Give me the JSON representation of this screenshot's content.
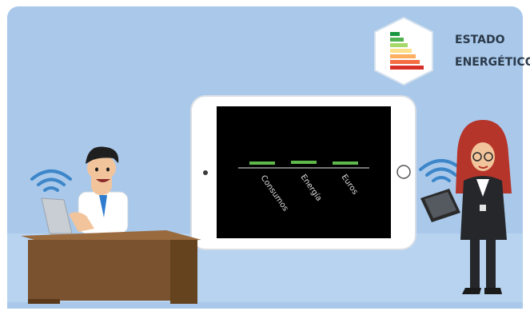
{
  "brand": {
    "line1": "ESTADO",
    "line2": "ENERGÉTICO",
    "icon": "energy-rating-icon",
    "color": "#2b3a4a"
  },
  "tablet": {
    "chart_labels": [
      "Consumos",
      "Energía",
      "Euros"
    ]
  },
  "colors": {
    "background": "#a9c8ea",
    "floor": "#b7d3f0",
    "screen": "#000000",
    "bar": "#5fb84a",
    "wave": "#3c86c9"
  }
}
